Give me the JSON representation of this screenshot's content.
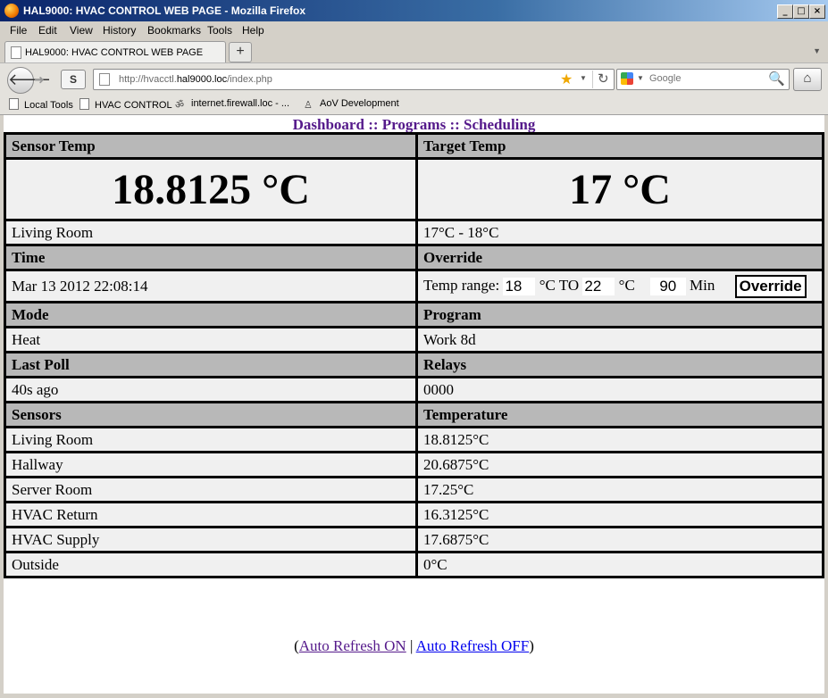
{
  "window": {
    "title": "HAL9000: HVAC CONTROL WEB PAGE - Mozilla Firefox"
  },
  "menu": [
    "File",
    "Edit",
    "View",
    "History",
    "Bookmarks",
    "Tools",
    "Help"
  ],
  "tab": {
    "label": "HAL9000: HVAC CONTROL WEB PAGE"
  },
  "address": {
    "prefix": "http://hvacctl.",
    "host": "hal9000.loc",
    "suffix": "/index.php"
  },
  "search": {
    "placeholder": "Google"
  },
  "bookmarks": [
    "Local Tools",
    "HVAC CONTROL",
    "internet.firewall.loc - ...",
    "AoV Development"
  ],
  "nav": {
    "dashboard": "Dashboard",
    "sep": "::",
    "programs": "Programs",
    "scheduling": "Scheduling"
  },
  "sensor_temp": {
    "header": "Sensor Temp",
    "value": "18.8125 °C",
    "location": "Living Room"
  },
  "target_temp": {
    "header": "Target Temp",
    "value": "17 °C",
    "range": "17°C - 18°C"
  },
  "time": {
    "header": "Time",
    "value": "Mar 13 2012 22:08:14"
  },
  "override": {
    "header": "Override",
    "range_label": "Temp range:",
    "low": "18",
    "unit_to": "°C TO",
    "high": "22",
    "unit": "°C",
    "minutes": "90",
    "min_label": "Min",
    "button": "Override"
  },
  "mode": {
    "header": "Mode",
    "value": "Heat"
  },
  "program": {
    "header": "Program",
    "value": "Work 8d"
  },
  "last_poll": {
    "header": "Last Poll",
    "value": "40s ago"
  },
  "relays": {
    "header": "Relays",
    "value": "0000"
  },
  "sensors": {
    "header_name": "Sensors",
    "header_temp": "Temperature",
    "rows": [
      {
        "name": "Living Room",
        "temp": "18.8125°C"
      },
      {
        "name": "Hallway",
        "temp": "20.6875°C"
      },
      {
        "name": "Server Room",
        "temp": "17.25°C"
      },
      {
        "name": "HVAC Return",
        "temp": "16.3125°C"
      },
      {
        "name": "HVAC Supply",
        "temp": "17.6875°C"
      },
      {
        "name": "Outside",
        "temp": "0°C"
      }
    ]
  },
  "refresh": {
    "open": "(",
    "on": "Auto Refresh ON",
    "sep": "|",
    "off": "Auto Refresh OFF",
    "close": ")"
  }
}
